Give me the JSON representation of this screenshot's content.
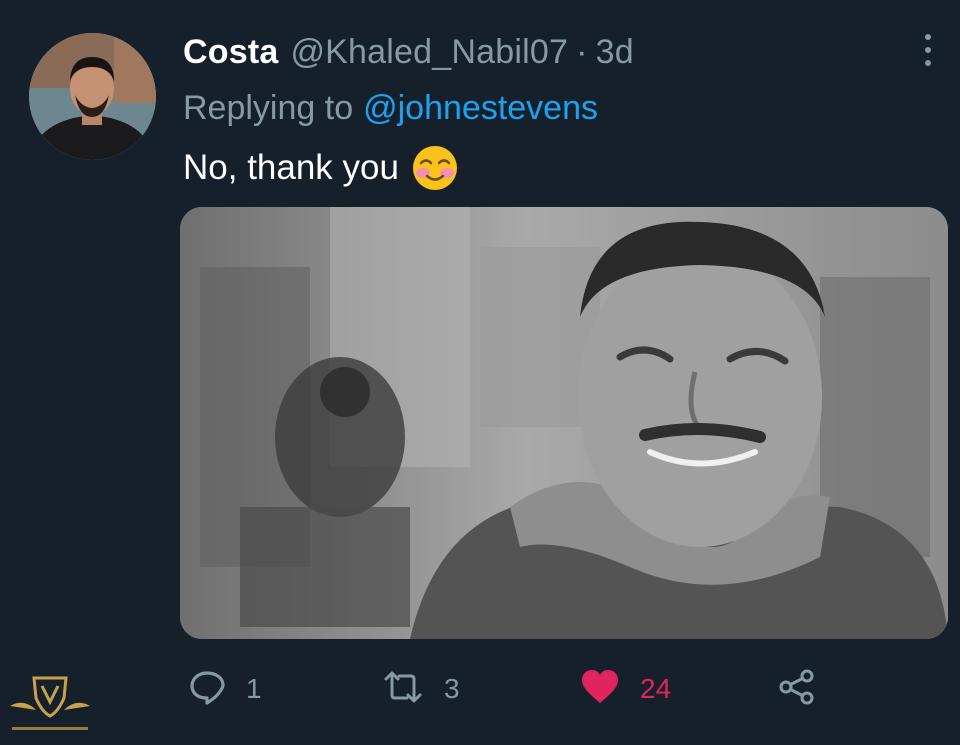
{
  "tweet": {
    "display_name": "Costa",
    "handle": "@Khaled_Nabil07",
    "separator": "·",
    "age": "3d",
    "replying_prefix": "Replying to",
    "replying_to": "@johnestevens",
    "text": "No, thank you",
    "emoji": "smiling-face-with-smiling-eyes",
    "media": {
      "description": "black-and-white photo"
    }
  },
  "actions": {
    "reply_count": "1",
    "retweet_count": "3",
    "like_count": "24",
    "liked": true
  },
  "icons": {
    "more": "more-vertical-icon",
    "reply": "reply-bubble-icon",
    "retweet": "retweet-icon",
    "like": "heart-icon",
    "share": "share-icon"
  },
  "colors": {
    "background": "#15202b",
    "text": "#ffffff",
    "muted": "#8899a6",
    "link": "#1da1f2",
    "like": "#e0245e"
  }
}
